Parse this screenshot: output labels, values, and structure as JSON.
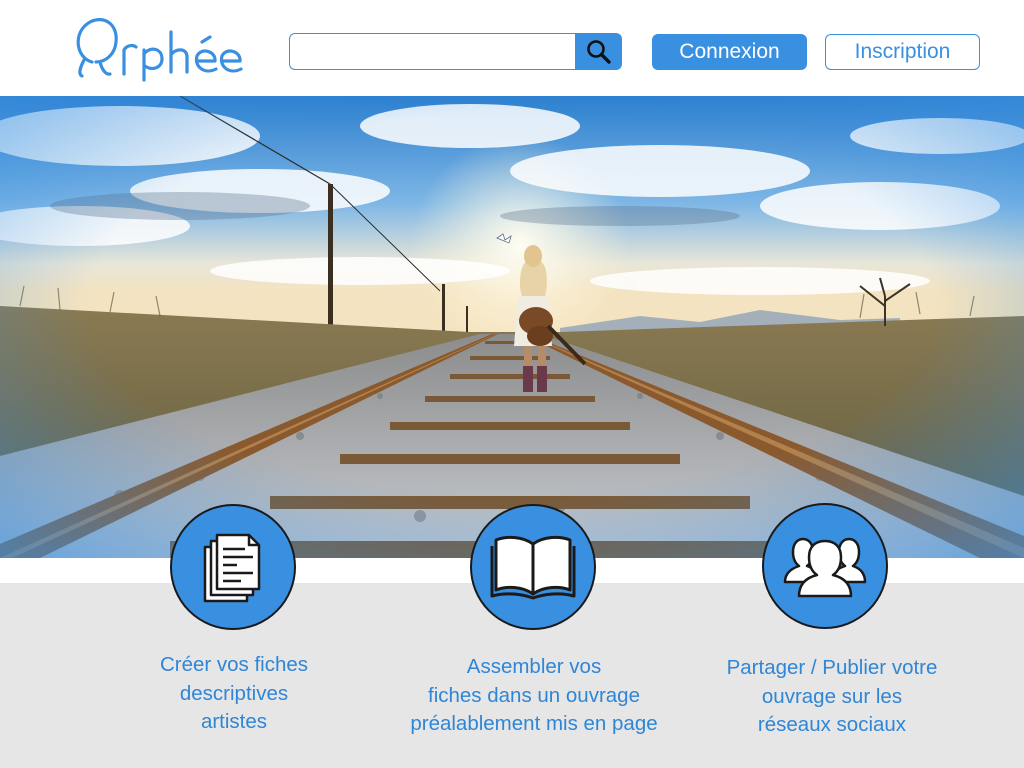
{
  "header": {
    "logo_text": "Orphée",
    "search": {
      "value": "",
      "placeholder": ""
    },
    "connexion_label": "Connexion",
    "inscription_label": "Inscription"
  },
  "hero": {
    "image_subject": "woman-with-guitar-walking-on-railway-tracks"
  },
  "features": [
    {
      "icon": "documents-icon",
      "lines": [
        "Créer vos fiches",
        "descriptives",
        "artistes"
      ]
    },
    {
      "icon": "open-book-icon",
      "lines": [
        "Assembler vos",
        "fiches dans un ouvrage",
        "préalablement mis en page"
      ]
    },
    {
      "icon": "users-icon",
      "lines": [
        "Partager / Publier votre",
        "ouvrage sur les",
        "réseaux sociaux"
      ]
    }
  ],
  "colors": {
    "accent": "#3a90e0",
    "text_accent": "#2f86d6",
    "band": "#e6e6e6"
  }
}
